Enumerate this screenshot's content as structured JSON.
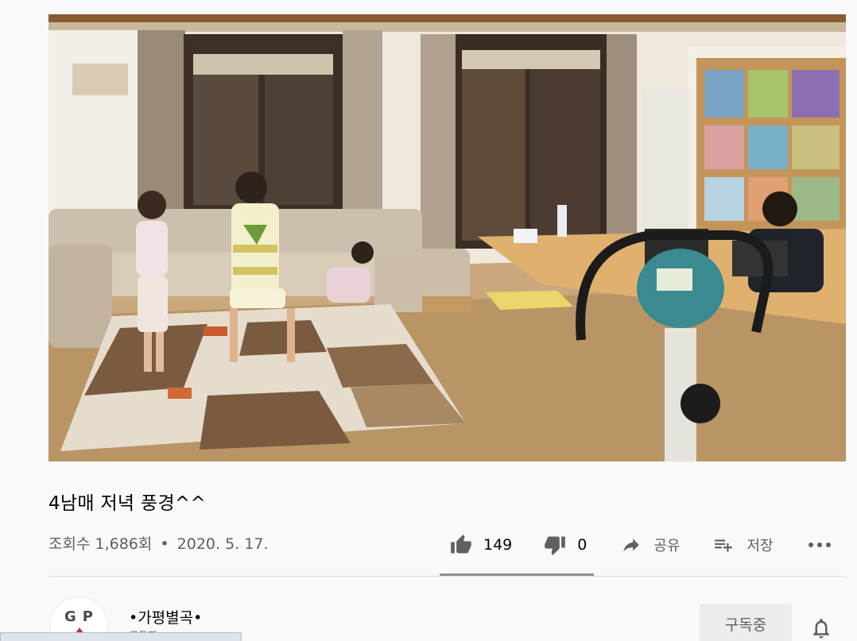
{
  "video": {
    "title": "4남매 저녁 풍경^^",
    "views": "조회수 1,686회",
    "separator": "•",
    "date": "2020. 5. 17."
  },
  "actions": {
    "like_count": "149",
    "dislike_count": "0",
    "share_label": "공유",
    "save_label": "저장",
    "icons": {
      "like": "thumbs-up-icon",
      "dislike": "thumbs-down-icon",
      "share": "share-arrow-icon",
      "save": "playlist-add-icon",
      "more": "more-horizontal-icon"
    }
  },
  "channel": {
    "avatar_text": "GP",
    "name": "•가평별곡•",
    "subtitle": "구독자 …",
    "subscribe_label": "구독중"
  },
  "statusbar": {
    "text": ""
  },
  "colors": {
    "background": "#f9f9f9",
    "text_primary": "#030303",
    "text_secondary": "#606060",
    "subscribe_bg": "#ececec",
    "like_bar": "#909090"
  }
}
